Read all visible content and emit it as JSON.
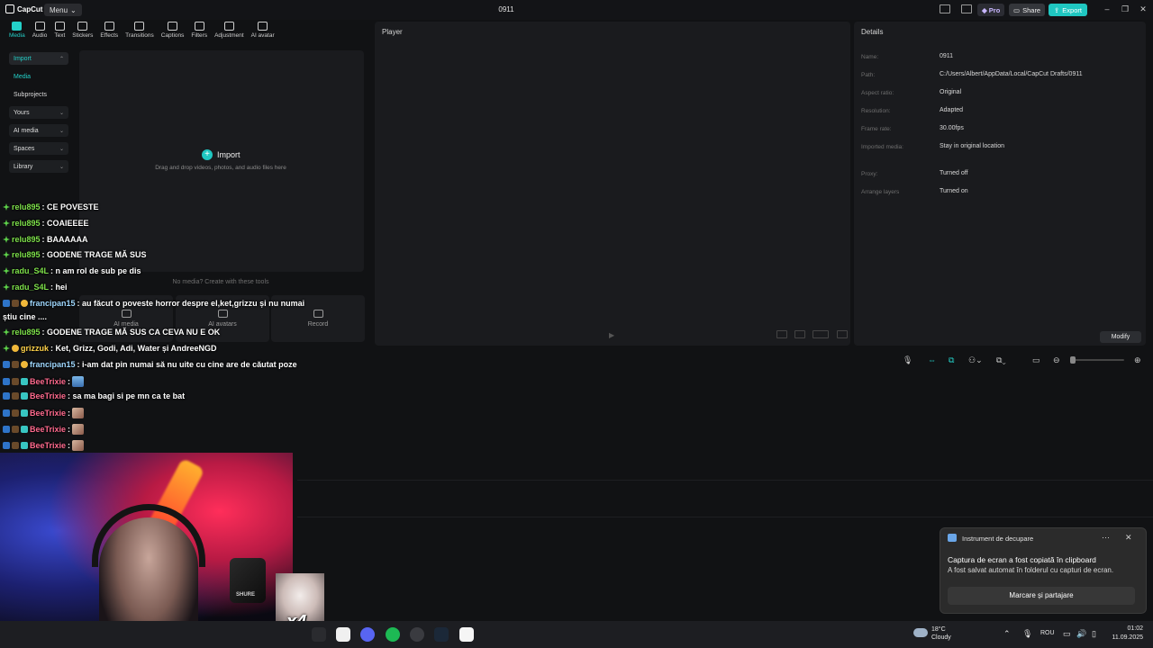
{
  "titlebar": {
    "app_name": "CapCut",
    "menu_label": "Menu",
    "project_title": "0911",
    "pro_label": "Pro",
    "share_label": "Share",
    "export_label": "Export"
  },
  "tool_tabs": [
    {
      "label": "Media",
      "active": true
    },
    {
      "label": "Audio"
    },
    {
      "label": "Text"
    },
    {
      "label": "Stickers"
    },
    {
      "label": "Effects"
    },
    {
      "label": "Transitions"
    },
    {
      "label": "Captions"
    },
    {
      "label": "Filters"
    },
    {
      "label": "Adjustment"
    },
    {
      "label": "AI avatar"
    }
  ],
  "sidebar": {
    "import": "Import",
    "media": "Media",
    "subprojects": "Subprojects",
    "yours": "Yours",
    "ai_media": "AI media",
    "spaces": "Spaces",
    "library": "Library"
  },
  "media_panel": {
    "import_label": "Import",
    "drop_hint": "Drag and drop videos, photos, and audio files here",
    "no_media": "No media? Create with these tools",
    "cards": [
      "AI media",
      "AI avatars",
      "Record"
    ]
  },
  "player": {
    "title": "Player"
  },
  "details": {
    "title": "Details",
    "rows": [
      {
        "label": "Name:",
        "value": "0911"
      },
      {
        "label": "Path:",
        "value": "C:/Users/Albert/AppData/Local/CapCut Drafts/0911"
      },
      {
        "label": "Aspect ratio:",
        "value": "Original"
      },
      {
        "label": "Resolution:",
        "value": "Adapted"
      },
      {
        "label": "Frame rate:",
        "value": "30.00fps"
      },
      {
        "label": "Imported media:",
        "value": "Stay in original location"
      },
      {
        "label": "Proxy:",
        "value": "Turned off"
      },
      {
        "label": "Arrange layers",
        "value": "Turned on"
      }
    ],
    "modify_label": "Modify"
  },
  "chat": [
    {
      "user": "relu895",
      "msg": ": CE POVESTE"
    },
    {
      "user": "relu895",
      "msg": ": COAIEEEE"
    },
    {
      "user": "relu895",
      "msg": ": BAAAAAA"
    },
    {
      "user": "relu895",
      "msg": ": GODENE TRAGE MĂ SUS"
    },
    {
      "user": "radu_S4L",
      "msg": ": n am rol de sub pe dis"
    },
    {
      "user": "radu_S4L",
      "msg": ": hei"
    },
    {
      "user": "francipan15",
      "msg": ": au făcut o poveste horror despre el,ket,grizzu și nu numai"
    },
    {
      "user": "",
      "msg": "știu cine ...."
    },
    {
      "user": "relu895",
      "msg": ": GODENE TRAGE MĂ SUS CA CEVA NU E OK"
    },
    {
      "user": "grizzuk",
      "msg": ": Ket, Grizz, Godi, Adi, Water și AndreeNGD"
    },
    {
      "user": "francipan15",
      "msg": ": i-am dat pin numai să nu uite cu cine are de căutat poze"
    },
    {
      "user": "BeeTrixie",
      "msg": ":"
    },
    {
      "user": "BeeTrixie",
      "msg": ": sa ma bagi si pe mn ca te bat"
    },
    {
      "user": "BeeTrixie",
      "msg": ":"
    },
    {
      "user": "BeeTrixie",
      "msg": ":"
    },
    {
      "user": "BeeTrixie",
      "msg": ":"
    }
  ],
  "webcam": {
    "mic_brand": "SHURE",
    "multiplier": "x4"
  },
  "toast": {
    "app": "Instrument de decupare",
    "title": "Captura de ecran a fost copiată în clipboard",
    "body": "A fost salvat automat în folderul cu capturi de ecran.",
    "button": "Marcare și partajare"
  },
  "taskbar": {
    "temp": "18°C",
    "weather": "Cloudy",
    "lang": "ROU",
    "time": "01:02",
    "date": "11.09.2025"
  },
  "colors": {
    "accent": "#1fc7c1",
    "background": "#111214",
    "panel": "#1a1b1e"
  }
}
